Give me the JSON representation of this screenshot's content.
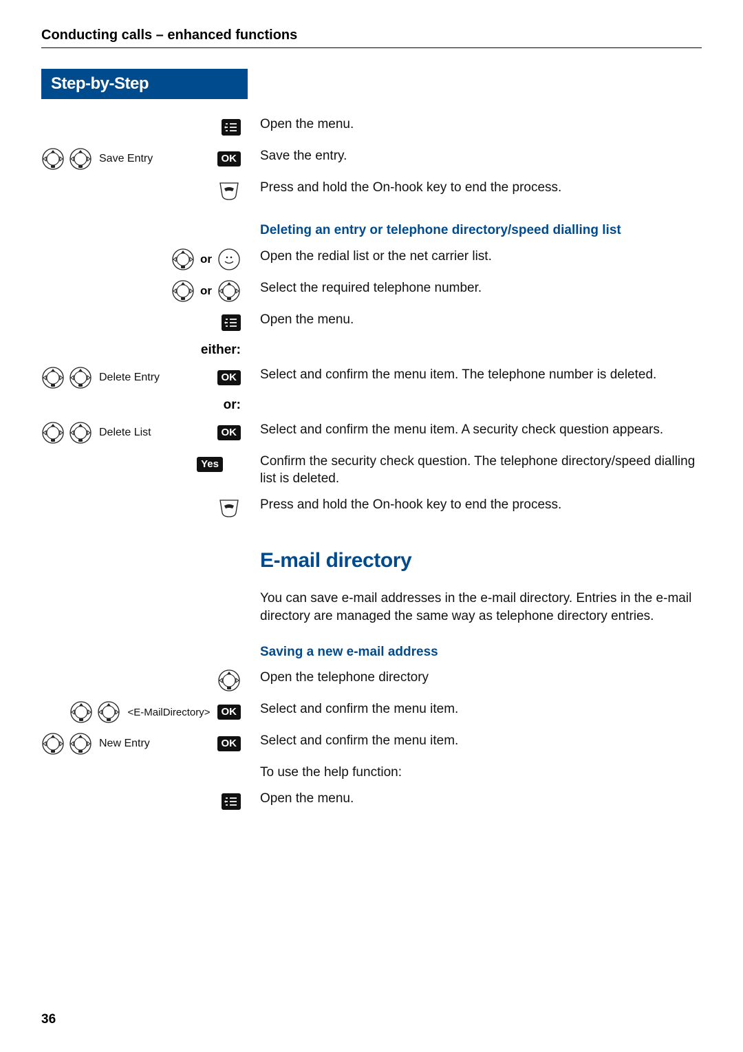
{
  "header": "Conducting calls – enhanced functions",
  "steps_title": "Step-by-Step",
  "labels": {
    "or": "or",
    "either": "either:",
    "or_colon": "or:",
    "ok": "OK"
  },
  "rows": {
    "open_menu1": {
      "text": "Open the menu."
    },
    "save_entry": {
      "menu": "Save Entry",
      "text": "Save the entry."
    },
    "hook1": {
      "text": "Press and hold the On-hook key to end the process."
    },
    "delete_heading": "Deleting an entry or telephone directory/speed dialling list",
    "open_redial": {
      "text": "Open the redial list or the net carrier list."
    },
    "select_tel": {
      "text": "Select the required telephone number."
    },
    "open_menu2": {
      "text": "Open the menu."
    },
    "delete_entry": {
      "menu": "Delete Entry",
      "text": "Select and confirm the menu item. The telephone number is deleted."
    },
    "delete_list": {
      "menu": "Delete List",
      "text": "Select and confirm the menu item. A security check question appears."
    },
    "yes": {
      "btn": "Yes",
      "text": "Confirm the security check question. The telephone directory/speed dialling list is deleted."
    },
    "hook2": {
      "text": "Press and hold the On-hook key to end the process."
    },
    "email_title": "E-mail directory",
    "email_intro": "You can save e-mail addresses in the e-mail directory. Entries in the e-mail directory are managed the same way as telephone directory entries.",
    "saving_heading": "Saving a new e-mail address",
    "open_dir": {
      "text": "Open the telephone directory"
    },
    "email_dir": {
      "menu": "<E-MailDirectory>",
      "text": "Select and confirm the menu item."
    },
    "new_entry": {
      "menu": "New Entry",
      "text": "Select and confirm the menu item."
    },
    "help_fn": {
      "text": "To use the help function:"
    },
    "open_menu3": {
      "text": "Open the menu."
    }
  },
  "page_number": "36"
}
